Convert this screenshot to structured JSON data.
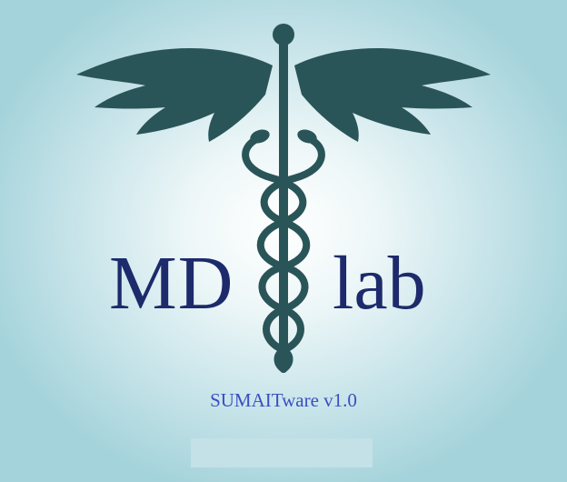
{
  "logo": {
    "left_text": "MD",
    "right_text": "lab",
    "emblem_icon": "caduceus-icon"
  },
  "version_label": "SUMAITware v1.0",
  "progress": {
    "fraction": 0.0
  },
  "colors": {
    "emblem": "#2a5558",
    "logo_text": "#1d2a6b",
    "version_text": "#3a4ec2",
    "background_center": "#ffffff",
    "background_edge": "#a5d3db"
  }
}
